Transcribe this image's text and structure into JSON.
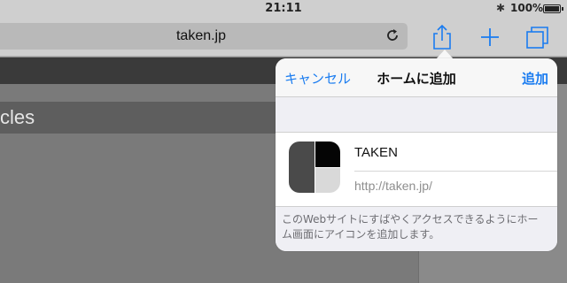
{
  "status_bar": {
    "time": "21:11",
    "bluetooth_icon": "bluetooth-icon",
    "battery_percent": "100%"
  },
  "toolbar": {
    "url": "taken.jp",
    "reload_icon": "reload-icon",
    "share_icon": "share-icon",
    "new_tab_icon": "plus-icon",
    "tabs_icon": "tabs-icon",
    "accent": "#1a7cf0"
  },
  "page": {
    "headline_fragment": "cles"
  },
  "add_to_home": {
    "cancel_label": "キャンセル",
    "title": "ホームに追加",
    "add_label": "追加",
    "app_name": "TAKEN",
    "app_url": "http://taken.jp/",
    "description": "このWebサイトにすばやくアクセスできるようにホーム画面にアイコンを追加します。"
  }
}
